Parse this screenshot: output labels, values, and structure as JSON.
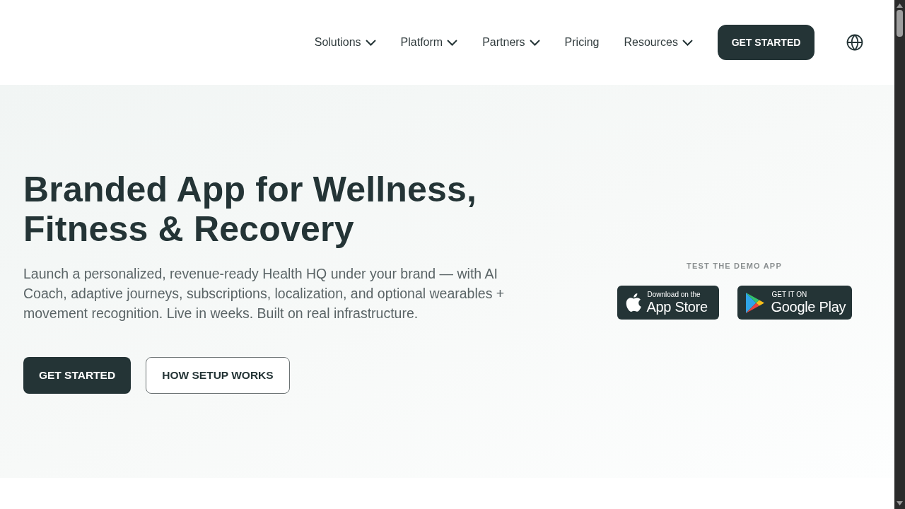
{
  "nav": {
    "items": [
      {
        "label": "Solutions",
        "kind": "dropdown"
      },
      {
        "label": "Platform",
        "kind": "dropdown"
      },
      {
        "label": "Partners",
        "kind": "dropdown"
      },
      {
        "label": "Pricing",
        "kind": "link"
      },
      {
        "label": "Resources",
        "kind": "dropdown"
      }
    ],
    "cta": "GET STARTED"
  },
  "hero": {
    "title": "Branded App for Wellness, Fitness & Recovery",
    "description": "Launch a personalized, revenue-ready Health HQ under your brand — with AI Coach, adaptive journeys, subscriptions, localization, and optional wearables + movement recognition. Live in weeks. Built on real infrastructure.",
    "buttons": [
      {
        "label": "GET STARTED",
        "kind": "primary"
      },
      {
        "label": "HOW SETUP WORKS",
        "kind": "outline"
      }
    ]
  },
  "demo": {
    "label": "TEST THE DEMO APP",
    "badges": [
      {
        "kind": "app_store",
        "small": "Download on the",
        "big": "App Store"
      },
      {
        "kind": "google_play",
        "small": "GET IT ON",
        "big": "Google Play"
      }
    ]
  }
}
